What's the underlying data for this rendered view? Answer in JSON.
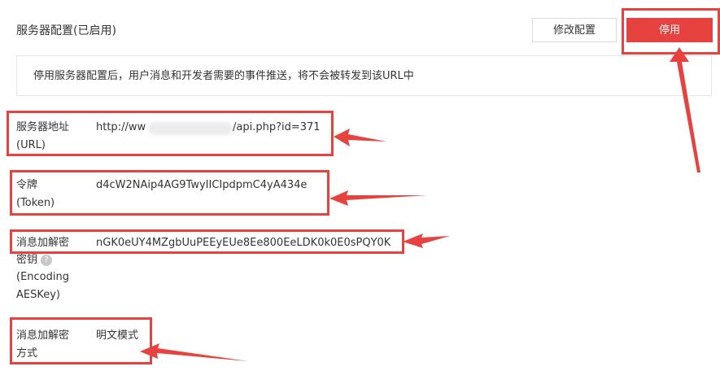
{
  "header": {
    "title": "服务器配置(已启用)",
    "edit_label": "修改配置",
    "stop_label": "停用"
  },
  "notice": "停用服务器配置后，用户消息和开发者需要的事件推送，将不会被转发到该URL中",
  "fields": {
    "url": {
      "label_line1": "服务器地址",
      "label_line2": "(URL)",
      "value_prefix": "http://ww",
      "value_suffix": "/api.php?id=371"
    },
    "token": {
      "label_line1": "令牌",
      "label_line2": "(Token)",
      "value": "d4cW2NAip4AG9TwyIICIpdpmC4yA434e"
    },
    "aes_key": {
      "label_line1": "消息加解密",
      "label_line2": "密钥",
      "label_line3": "(Encoding",
      "label_line4": "AESKey)",
      "value": "nGK0eUY4MZgbUuPEEyEUe8Ee800EeLDK0k0E0sPQY0K"
    },
    "mode": {
      "label_line1": "消息加解密",
      "label_line2": "方式",
      "value": "明文模式"
    }
  },
  "help_icon": "question-circle-icon",
  "colors": {
    "accent_red": "#e64340",
    "border": "#e7e7eb"
  }
}
